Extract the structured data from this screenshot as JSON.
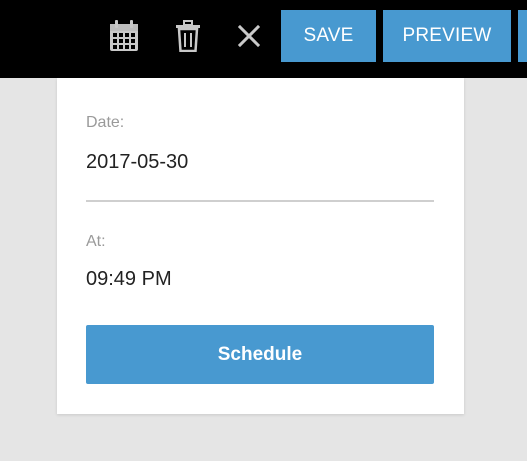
{
  "toolbar": {
    "icons": {
      "calendar": "calendar-icon",
      "trash": "trash-icon",
      "close": "close-icon"
    },
    "save_label": "SAVE",
    "preview_label": "PREVIEW"
  },
  "form": {
    "date_label": "Date:",
    "date_value": "2017-05-30",
    "time_label": "At:",
    "time_value": "09:49 PM",
    "schedule_label": "Schedule"
  },
  "colors": {
    "accent": "#4899d0",
    "topbar": "#000000",
    "background": "#e5e5e5"
  }
}
